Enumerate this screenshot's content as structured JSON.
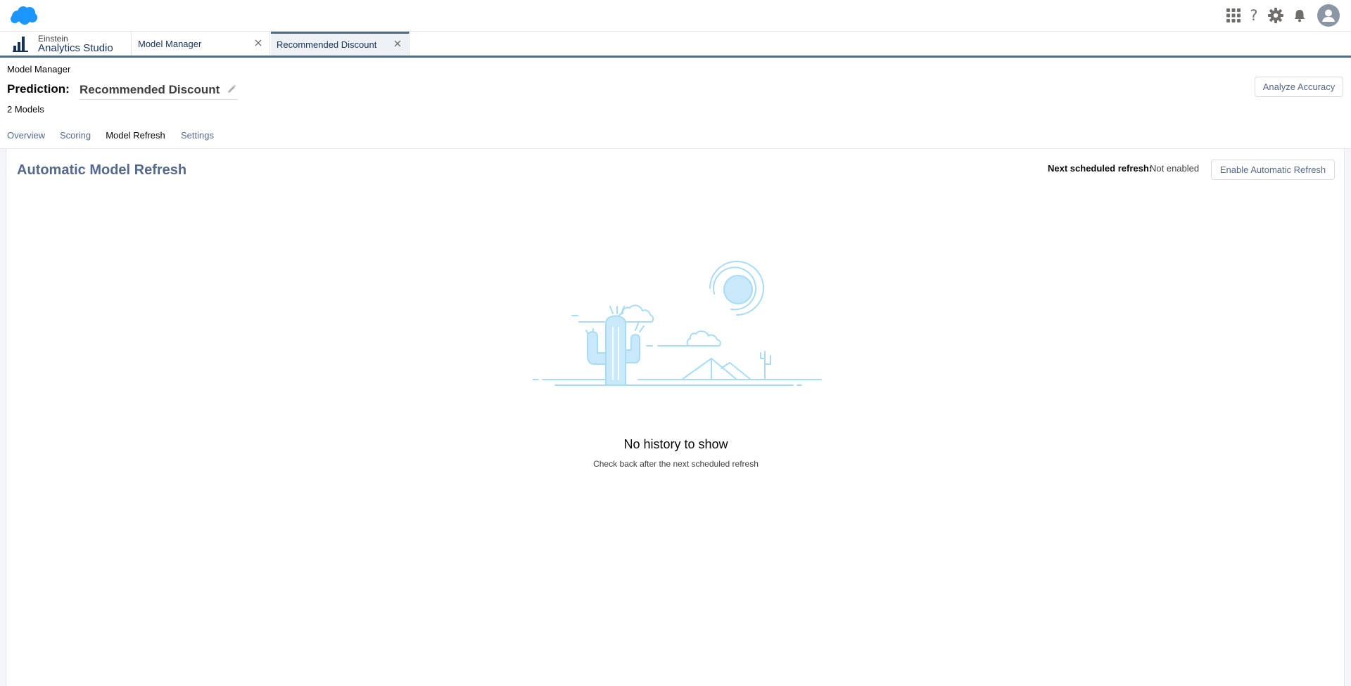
{
  "app": {
    "sub_name": "Einstein",
    "name": "Analytics Studio"
  },
  "header": {
    "help_glyph": "?",
    "icons": [
      "salesforce-cloud-logo",
      "app-launcher-icon",
      "help-icon",
      "setup-gear-icon",
      "notifications-bell-icon",
      "user-avatar-icon"
    ]
  },
  "tabs": [
    {
      "label": "Model Manager",
      "active": false
    },
    {
      "label": "Recommended Discount",
      "active": true
    }
  ],
  "page": {
    "breadcrumb": "Model Manager",
    "prediction_label": "Prediction:",
    "prediction_name": "Recommended Discount",
    "models_count": "2 Models",
    "analyze_button": "Analyze Accuracy"
  },
  "sub_tabs": [
    {
      "label": "Overview",
      "active": false
    },
    {
      "label": "Scoring",
      "active": false
    },
    {
      "label": "Model Refresh",
      "active": true
    },
    {
      "label": "Settings",
      "active": false
    }
  ],
  "refresh": {
    "title": "Automatic Model Refresh",
    "next_label": "Next scheduled refresh:",
    "next_value": "Not enabled",
    "enable_button": "Enable Automatic Refresh"
  },
  "empty_state": {
    "title": "No history to show",
    "subtitle": "Check back after the next scheduled refresh"
  },
  "colors": {
    "brand_cloud": "#1b96ff",
    "accent": "#4e6e87",
    "icon_gray": "#706e6b",
    "illustration_light": "#c9e9fb",
    "illustration_line": "#a8dcf5"
  }
}
